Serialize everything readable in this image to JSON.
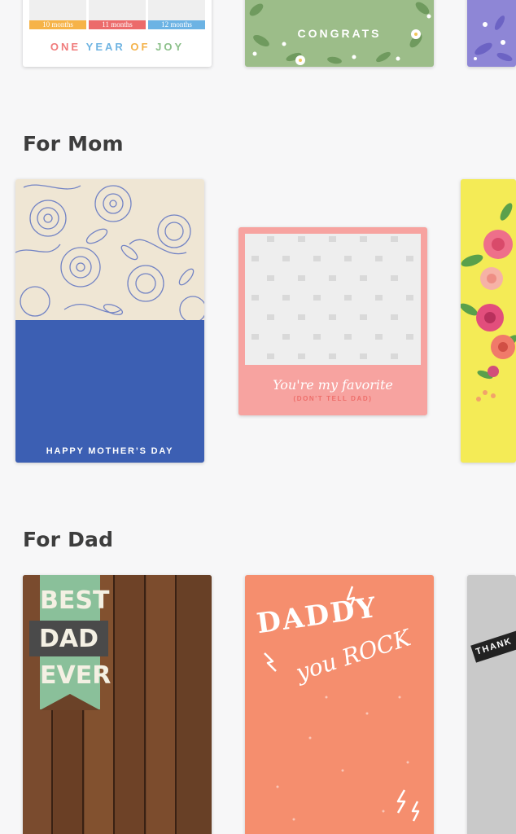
{
  "top_row": {
    "joy_card": {
      "months": [
        {
          "label": "10 months",
          "color": "#f6b348"
        },
        {
          "label": "11 months",
          "color": "#ec6b6b"
        },
        {
          "label": "12 months",
          "color": "#6cb3e4"
        }
      ],
      "caption_words": [
        {
          "text": "ONE",
          "color": "#f07b7b"
        },
        {
          "text": "YEAR",
          "color": "#6fb4e2"
        },
        {
          "text": "OF",
          "color": "#f4b24a"
        },
        {
          "text": "JOY",
          "color": "#8cc08a"
        }
      ]
    },
    "congrats_card": {
      "text": "CONGRATS"
    }
  },
  "sections": {
    "mom": {
      "title": "For Mom",
      "mothers_day_card": {
        "text": "HAPPY MOTHER’S DAY"
      },
      "favorite_card": {
        "script": "You're my favorite",
        "sub": "(DON'T TELL DAD)"
      }
    },
    "dad": {
      "title": "For Dad",
      "best_dad_card": {
        "word1": "BEST",
        "word2": "DAD",
        "word3": "EVER"
      },
      "daddy_card": {
        "line1": "DADDY",
        "line2": "you ROCK"
      },
      "thanks_card": {
        "text": "THANK"
      }
    }
  },
  "colors": {
    "background": "#f7f7f8",
    "mothers_day_blue": "#3c5fb3",
    "favorite_pink": "#f7a3a0",
    "daddy_orange": "#f58e6e",
    "flowers_yellow": "#f4eb56"
  }
}
